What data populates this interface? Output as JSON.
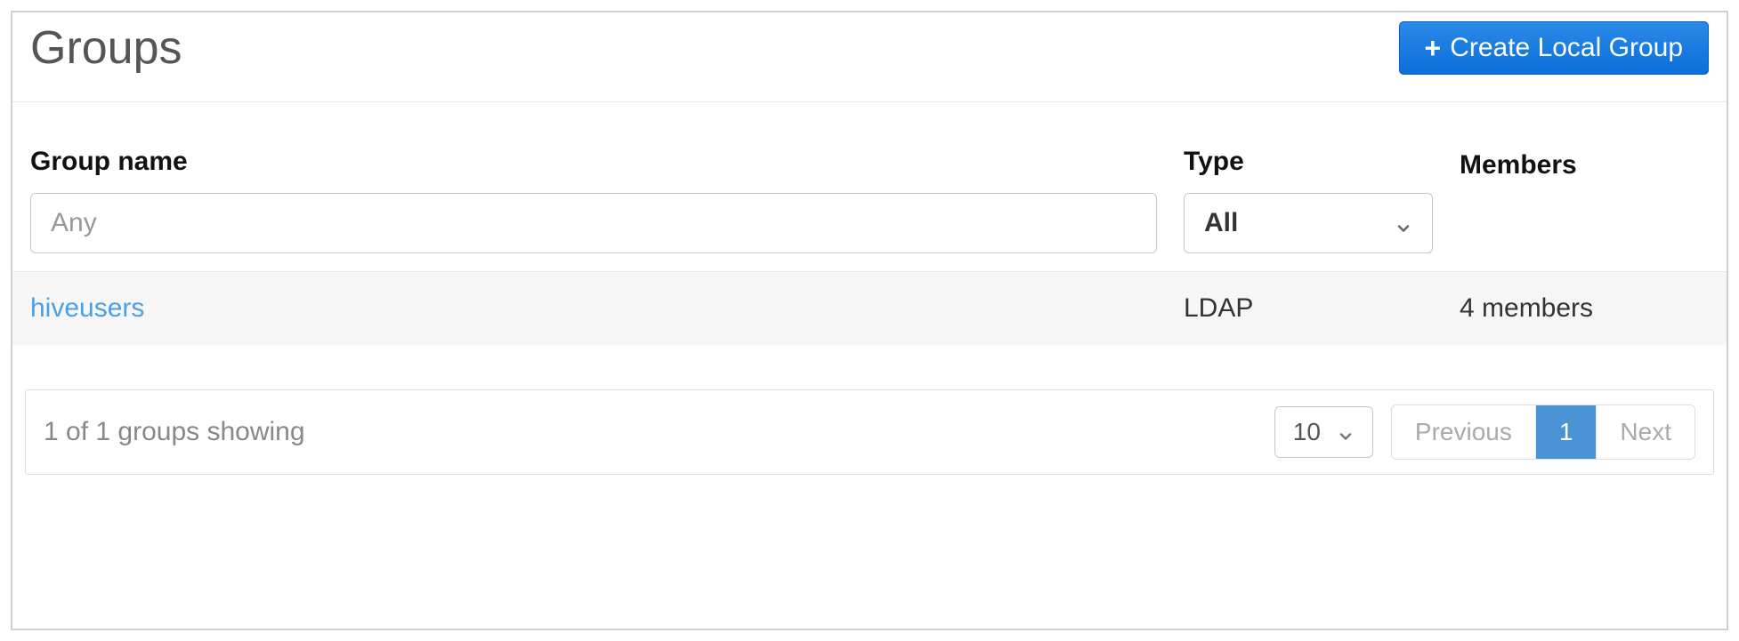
{
  "header": {
    "title": "Groups",
    "create_button": "Create Local Group"
  },
  "columns": {
    "name_label": "Group name",
    "type_label": "Type",
    "members_label": "Members"
  },
  "filters": {
    "name_placeholder": "Any",
    "type_selected": "All"
  },
  "rows": [
    {
      "name": "hiveusers",
      "type": "LDAP",
      "members": "4 members"
    }
  ],
  "footer": {
    "status": "1 of 1 groups showing",
    "page_size": "10",
    "pager": {
      "prev": "Previous",
      "current": "1",
      "next": "Next"
    }
  }
}
